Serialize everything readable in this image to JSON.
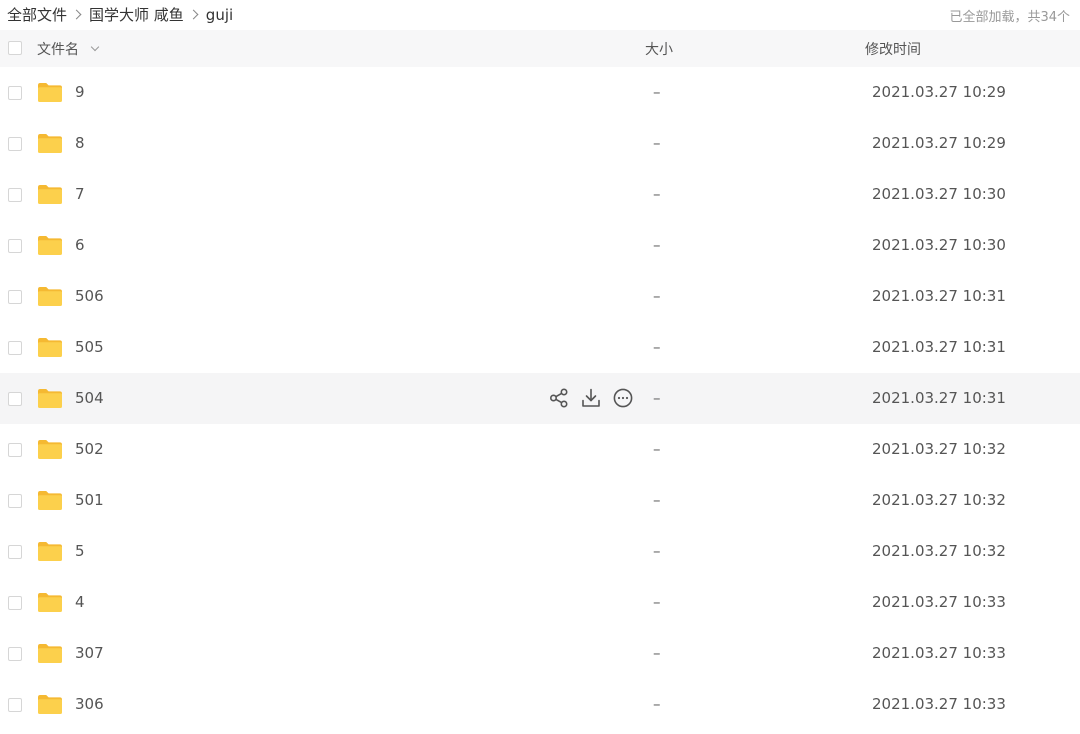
{
  "breadcrumb": [
    "全部文件",
    "国学大师 咸鱼",
    "guji"
  ],
  "load_status": "已全部加载，共34个",
  "columns": {
    "name": "文件名",
    "size": "大小",
    "modified": "修改时间"
  },
  "accent_color": "#FCD04C",
  "files": [
    {
      "name": "9",
      "size": "–",
      "modified": "2021.03.27 10:29"
    },
    {
      "name": "8",
      "size": "–",
      "modified": "2021.03.27 10:29"
    },
    {
      "name": "7",
      "size": "–",
      "modified": "2021.03.27 10:30"
    },
    {
      "name": "6",
      "size": "–",
      "modified": "2021.03.27 10:30"
    },
    {
      "name": "506",
      "size": "–",
      "modified": "2021.03.27 10:31"
    },
    {
      "name": "505",
      "size": "–",
      "modified": "2021.03.27 10:31"
    },
    {
      "name": "504",
      "size": "–",
      "modified": "2021.03.27 10:31",
      "hovered": true
    },
    {
      "name": "502",
      "size": "–",
      "modified": "2021.03.27 10:32"
    },
    {
      "name": "501",
      "size": "–",
      "modified": "2021.03.27 10:32"
    },
    {
      "name": "5",
      "size": "–",
      "modified": "2021.03.27 10:32"
    },
    {
      "name": "4",
      "size": "–",
      "modified": "2021.03.27 10:33"
    },
    {
      "name": "307",
      "size": "–",
      "modified": "2021.03.27 10:33"
    },
    {
      "name": "306",
      "size": "–",
      "modified": "2021.03.27 10:33"
    }
  ],
  "row_actions": [
    "share-icon",
    "download-icon",
    "more-icon"
  ]
}
